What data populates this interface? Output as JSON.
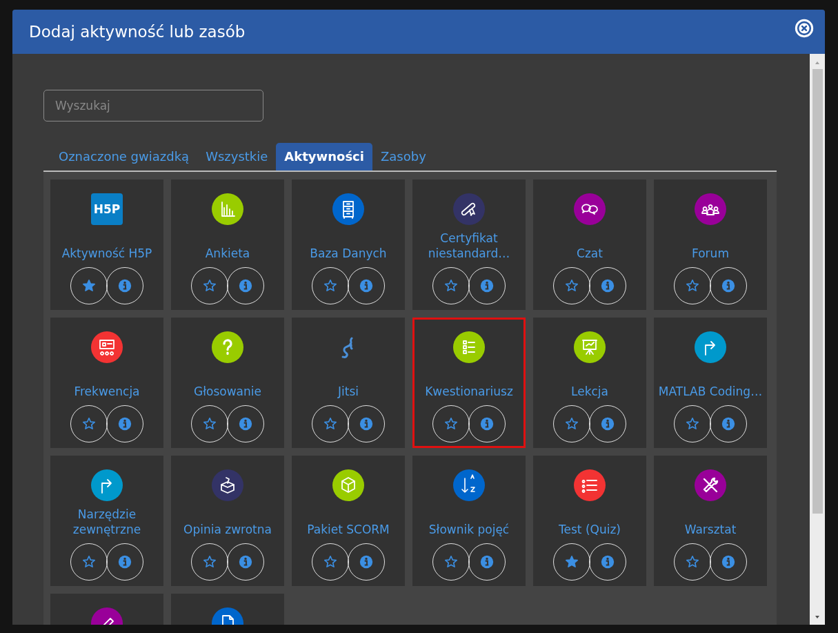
{
  "window": {
    "title": "Dodaj aktywność lub zasób"
  },
  "search": {
    "placeholder": "Wyszukaj"
  },
  "tabs": [
    {
      "label": "Oznaczone gwiazdką",
      "selected": false
    },
    {
      "label": "Wszystkie",
      "selected": false
    },
    {
      "label": "Aktywności",
      "selected": true
    },
    {
      "label": "Zasoby",
      "selected": false
    }
  ],
  "items": [
    {
      "kind": "logo",
      "logo_text": "H5P",
      "color": "#0a7fc6",
      "label": "Aktywność H5P",
      "starred": true,
      "highlighted": false
    },
    {
      "kind": "circle",
      "color": "#99cc00",
      "label": "Ankieta",
      "starred": false,
      "highlighted": false
    },
    {
      "kind": "circle",
      "color": "#0066cc",
      "label": "Baza Danych",
      "starred": false,
      "highlighted": false
    },
    {
      "kind": "circle",
      "color": "#333366",
      "label": "Certyfikat niestandard…",
      "starred": false,
      "highlighted": false
    },
    {
      "kind": "circle",
      "color": "#990099",
      "label": "Czat",
      "starred": false,
      "highlighted": false
    },
    {
      "kind": "circle",
      "color": "#990099",
      "label": "Forum",
      "starred": false,
      "highlighted": false
    },
    {
      "kind": "circle",
      "color": "#f33333",
      "label": "Frekwencja",
      "starred": false,
      "highlighted": false
    },
    {
      "kind": "circle",
      "color": "#99cc00",
      "label": "Głosowanie",
      "starred": false,
      "highlighted": false
    },
    {
      "kind": "plain",
      "color": "#4a90d9",
      "label": "Jitsi",
      "starred": false,
      "highlighted": false
    },
    {
      "kind": "circle",
      "color": "#99cc00",
      "label": "Kwestionariusz",
      "starred": false,
      "highlighted": true
    },
    {
      "kind": "circle",
      "color": "#99cc00",
      "label": "Lekcja",
      "starred": false,
      "highlighted": false
    },
    {
      "kind": "circle",
      "color": "#0099cc",
      "label": "MATLAB Coding…",
      "starred": false,
      "highlighted": false
    },
    {
      "kind": "circle",
      "color": "#0099cc",
      "label": "Narzędzie zewnętrzne",
      "starred": false,
      "highlighted": false
    },
    {
      "kind": "circle",
      "color": "#333366",
      "label": "Opinia zwrotna",
      "starred": false,
      "highlighted": false
    },
    {
      "kind": "circle",
      "color": "#99cc00",
      "label": "Pakiet SCORM",
      "starred": false,
      "highlighted": false
    },
    {
      "kind": "circle",
      "color": "#0066cc",
      "label": "Słownik pojęć",
      "starred": false,
      "highlighted": false
    },
    {
      "kind": "circle",
      "color": "#f33333",
      "label": "Test (Quiz)",
      "starred": true,
      "highlighted": false
    },
    {
      "kind": "circle",
      "color": "#990099",
      "label": "Warsztat",
      "starred": false,
      "highlighted": false
    },
    {
      "kind": "circle",
      "color": "#990099",
      "highlighted": false
    },
    {
      "kind": "circle",
      "color": "#0066cc",
      "highlighted": false
    }
  ]
}
